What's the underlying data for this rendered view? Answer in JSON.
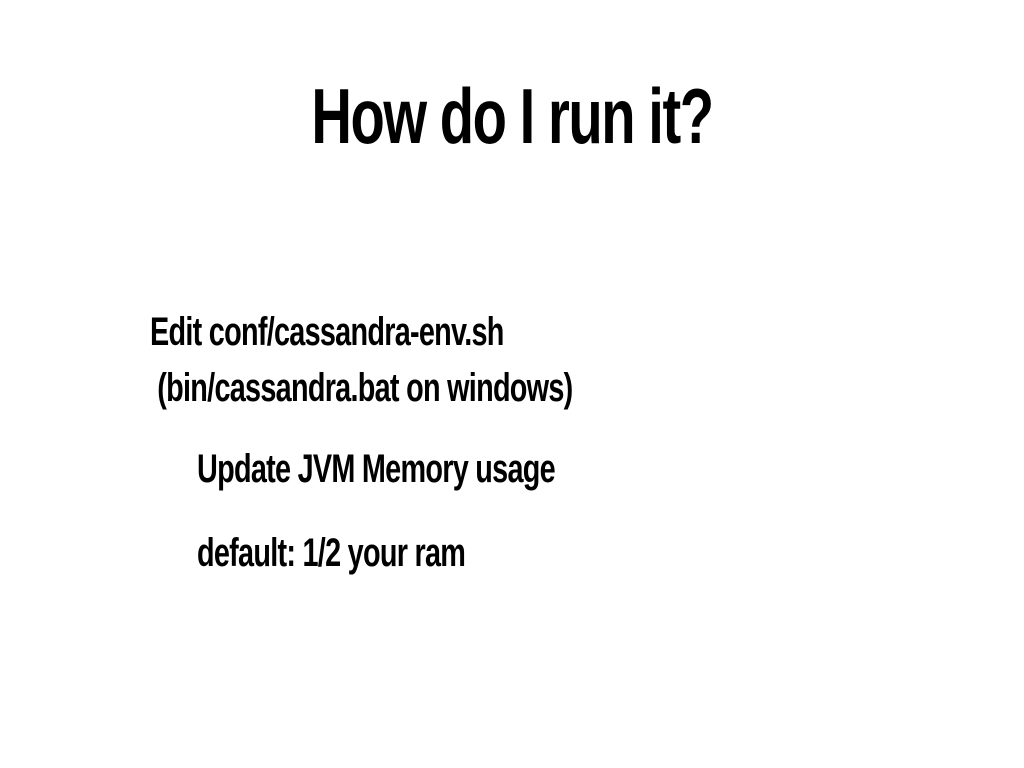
{
  "slide": {
    "title": "How do I run it?",
    "lines": [
      "Edit conf/cassandra-env.sh",
      " (bin/cassandra.bat on windows)",
      "Update JVM Memory usage",
      "default: 1/2 your ram"
    ]
  }
}
